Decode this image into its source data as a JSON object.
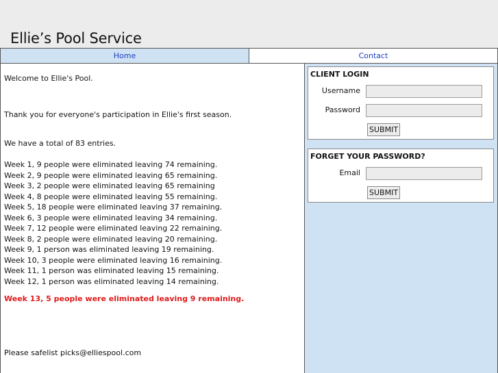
{
  "site": {
    "title": "Ellie’s Pool Service"
  },
  "nav": {
    "home": "Home",
    "contact": "Contact"
  },
  "main": {
    "welcome": "Welcome to Ellie's Pool.",
    "thanks": "Thank you for everyone's participation in Ellie's first season.",
    "total": "We have a total of 83 entries.",
    "weeks": [
      "Week 1, 9 people were eliminated leaving 74 remaining.",
      "Week 2, 9 people were eliminated leaving 65 remaining.",
      "Week 3, 2 people were eliminated leaving 65 remaining",
      "Week 4, 8 people were eliminated leaving 55 remaining.",
      "Week 5, 18 people were eliminated leaving 37 remaining.",
      "Week 6, 3 people were eliminated leaving 34 remaining.",
      "Week 7, 12 people were eliminated leaving 22 remaining.",
      "Week 8, 2 people were eliminated leaving 20 remaining.",
      "Week 9, 1 person was eliminated leaving 19 remaining.",
      "Week 10, 3 people were eliminated leaving 16 remaining.",
      "Week 11, 1 person was eliminated leaving 15 remaining.",
      "Week 12, 1 person was eliminated leaving 14 remaining."
    ],
    "highlight": "Week 13, 5 people were eliminated leaving 9 remaining.",
    "safelist": "Please safelist picks@elliespool.com"
  },
  "login": {
    "title": "CLIENT LOGIN",
    "username_label": "Username",
    "username_value": "",
    "password_label": "Password",
    "password_value": "",
    "submit": "SUBMIT"
  },
  "forgot": {
    "title": "FORGET YOUR PASSWORD?",
    "email_label": "Email",
    "email_value": "",
    "submit": "SUBMIT"
  },
  "colors": {
    "highlight": "#e01b1b",
    "nav_link": "#1a3fc2",
    "sidebar_bg": "#cfe2f3"
  }
}
